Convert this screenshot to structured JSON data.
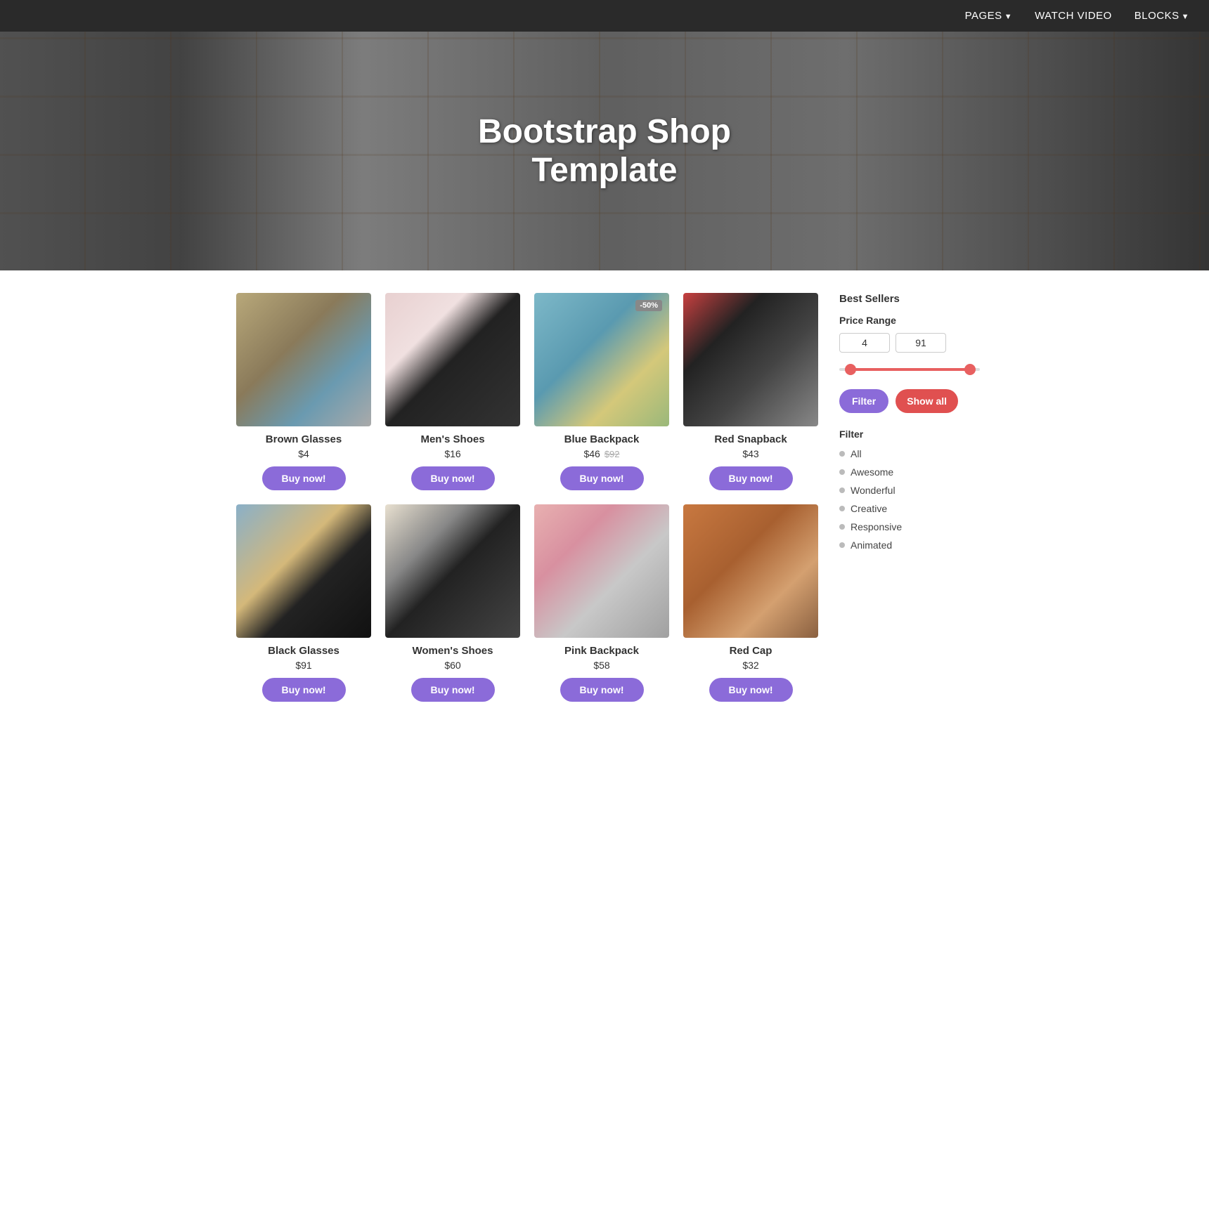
{
  "navbar": {
    "pages_label": "PAGES",
    "watch_video_label": "WATCH VIDEO",
    "blocks_label": "BLOCKS"
  },
  "hero": {
    "title_line1": "Bootstrap Shop",
    "title_line2": "Template"
  },
  "products": [
    {
      "id": "brown-glasses",
      "name": "Brown Glasses",
      "price": "$4",
      "original_price": null,
      "discount": null,
      "img_class": "img-brown-glasses",
      "buy_label": "Buy now!"
    },
    {
      "id": "mens-shoes",
      "name": "Men's Shoes",
      "price": "$16",
      "original_price": null,
      "discount": null,
      "img_class": "img-mens-shoes",
      "buy_label": "Buy now!"
    },
    {
      "id": "blue-backpack",
      "name": "Blue Backpack",
      "price": "$46",
      "original_price": "$92",
      "discount": "-50%",
      "img_class": "img-blue-backpack",
      "buy_label": "Buy now!"
    },
    {
      "id": "red-snapback",
      "name": "Red Snapback",
      "price": "$43",
      "original_price": null,
      "discount": null,
      "img_class": "img-red-snapback",
      "buy_label": "Buy now!"
    },
    {
      "id": "black-glasses",
      "name": "Black Glasses",
      "price": "$91",
      "original_price": null,
      "discount": null,
      "img_class": "img-black-glasses",
      "buy_label": "Buy now!"
    },
    {
      "id": "womens-shoes",
      "name": "Women's Shoes",
      "price": "$60",
      "original_price": null,
      "discount": null,
      "img_class": "img-womens-shoes",
      "buy_label": "Buy now!"
    },
    {
      "id": "pink-backpack",
      "name": "Pink Backpack",
      "price": "$58",
      "original_price": null,
      "discount": null,
      "img_class": "img-pink-backpack",
      "buy_label": "Buy now!"
    },
    {
      "id": "red-cap",
      "name": "Red Cap",
      "price": "$32",
      "original_price": null,
      "discount": null,
      "img_class": "img-red-cap",
      "buy_label": "Buy now!"
    }
  ],
  "sidebar": {
    "section_title": "Best Sellers",
    "price_range_label": "Price Range",
    "price_min": "4",
    "price_max": "91",
    "filter_btn_label": "Filter",
    "show_all_btn_label": "Show all",
    "filter_title": "Filter",
    "filter_items": [
      {
        "label": "All"
      },
      {
        "label": "Awesome"
      },
      {
        "label": "Wonderful"
      },
      {
        "label": "Creative"
      },
      {
        "label": "Responsive"
      },
      {
        "label": "Animated"
      }
    ]
  }
}
